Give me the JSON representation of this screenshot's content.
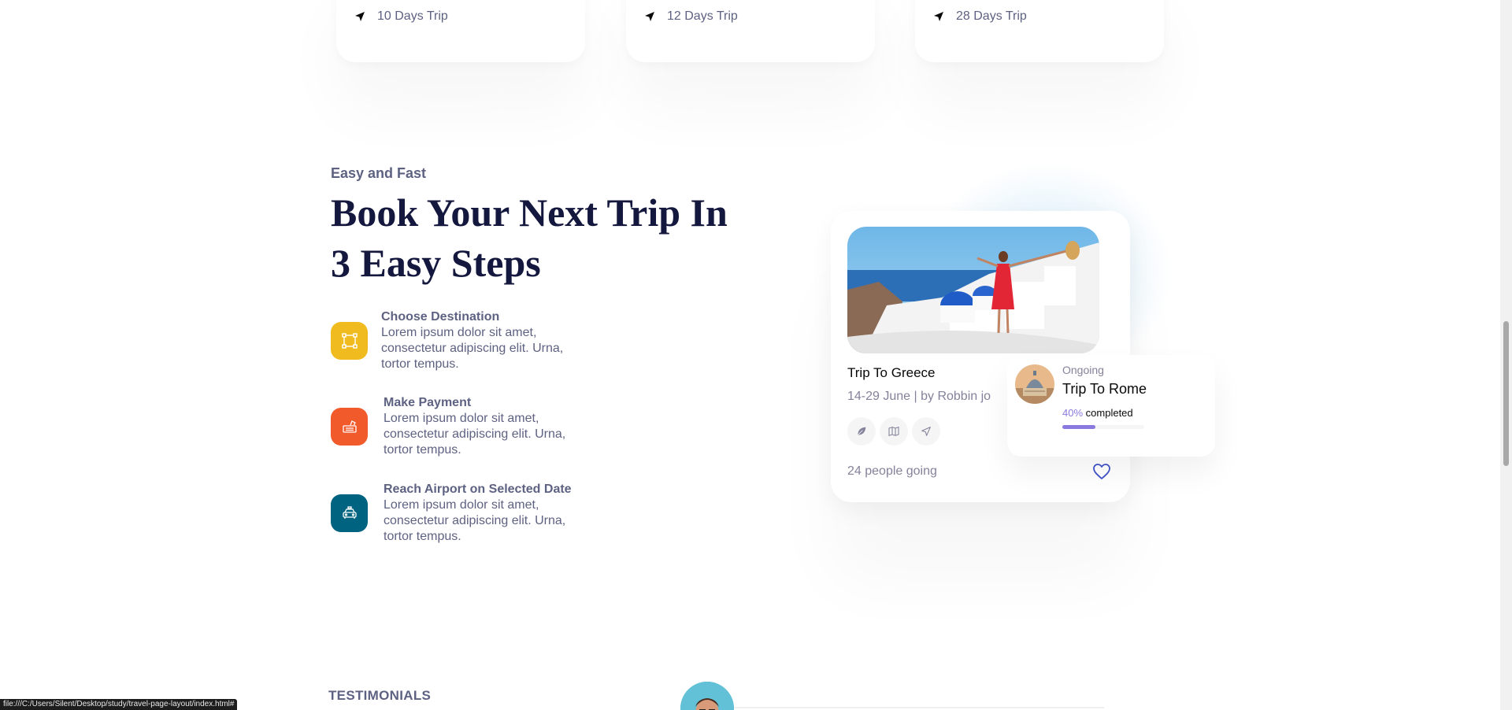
{
  "destinations": [
    {
      "duration": "10 Days Trip"
    },
    {
      "duration": "12 Days Trip"
    },
    {
      "duration": "28 Days Trip"
    }
  ],
  "booking": {
    "subtitle": "Easy and Fast",
    "heading": "Book Your Next Trip In 3 Easy Steps",
    "steps": [
      {
        "title": "Choose Destination",
        "desc": "Lorem ipsum dolor sit amet, consectetur adipiscing elit. Urna, tortor tempus.",
        "icon": "selection-icon",
        "color": "#F0BB1F"
      },
      {
        "title": "Make Payment",
        "desc": "Lorem ipsum dolor sit amet, consectetur adipiscing elit. Urna, tortor tempus.",
        "icon": "payment-icon",
        "color": "#F15A2B"
      },
      {
        "title": "Reach Airport on Selected Date",
        "desc": "Lorem ipsum dolor sit amet, consectetur adipiscing elit. Urna, tortor tempus.",
        "icon": "taxi-icon",
        "color": "#006380"
      }
    ]
  },
  "trip_card": {
    "title": "Trip To Greece",
    "meta": "14-29 June | by Robbin jo",
    "people": "24 people going",
    "icons": [
      "leaf-icon",
      "map-icon",
      "send-icon"
    ]
  },
  "ongoing": {
    "label": "Ongoing",
    "name": "Trip To Rome",
    "percent_text": "40%",
    "completed_text": "completed",
    "progress": 0.4
  },
  "testimonials": {
    "label": "TESTIMONIALS"
  },
  "status_url": "file:///C:/Users/Silent/Desktop/study/travel-page-layout/index.html#",
  "colors": {
    "heading": "#14183E",
    "text": "#5E6282",
    "accent": "#8A79DF"
  }
}
